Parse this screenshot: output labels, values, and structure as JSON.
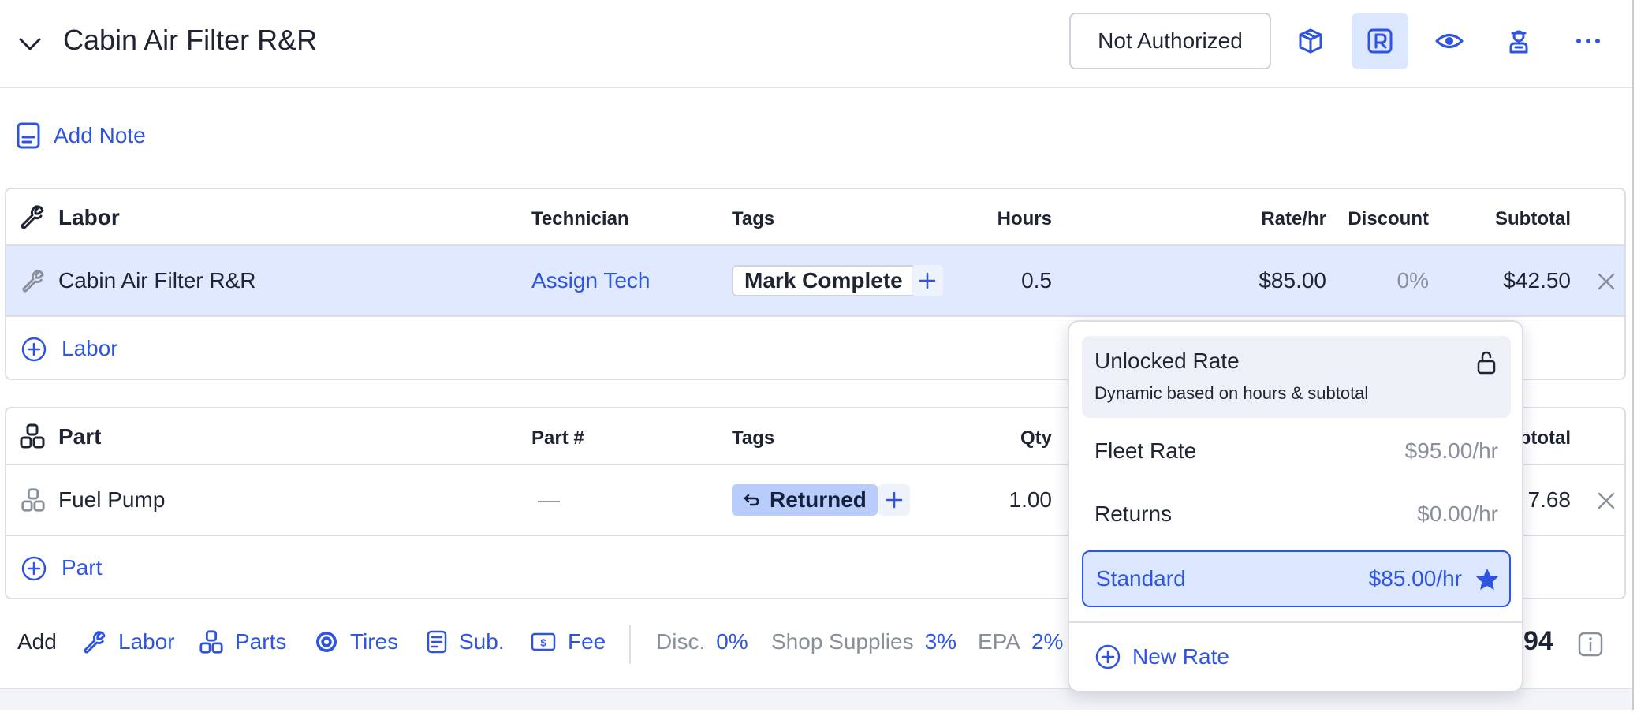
{
  "header": {
    "title": "Cabin Air Filter R&R",
    "authorization_status": "Not Authorized",
    "icons": [
      "chevron-down-icon",
      "package-icon",
      "r-badge-icon",
      "eye-icon",
      "technician-icon",
      "more-horizontal-icon"
    ]
  },
  "notes": {
    "add_label": "Add Note"
  },
  "labor_table": {
    "headers": {
      "section": "Labor",
      "technician": "Technician",
      "tags": "Tags",
      "hours": "Hours",
      "rate": "Rate/hr",
      "discount": "Discount",
      "subtotal": "Subtotal"
    },
    "rows": [
      {
        "name": "Cabin Air Filter R&R",
        "technician": "Assign Tech",
        "tag": "Mark Complete",
        "hours": "0.5",
        "rate": "$85.00",
        "discount": "0%",
        "subtotal": "$42.50"
      }
    ],
    "add_label": "Labor"
  },
  "part_table": {
    "headers": {
      "section": "Part",
      "part_number": "Part #",
      "tags": "Tags",
      "qty": "Qty",
      "subtotal_partial": "btotal"
    },
    "rows": [
      {
        "name": "Fuel Pump",
        "part_number": "—",
        "tag": "Returned",
        "qty": "1.00",
        "subtotal_partial": "7.68"
      }
    ],
    "add_label": "Part"
  },
  "footer": {
    "add_label": "Add",
    "add_items": [
      {
        "label": "Labor",
        "icon": "wrench-icon"
      },
      {
        "label": "Parts",
        "icon": "parts-icon"
      },
      {
        "label": "Tires",
        "icon": "tire-icon"
      },
      {
        "label": "Sub.",
        "icon": "sublet-icon"
      },
      {
        "label": "Fee",
        "icon": "fee-icon"
      }
    ],
    "disc_label": "Disc.",
    "disc_value": "0%",
    "shop_supplies_label": "Shop Supplies",
    "shop_supplies_value": "3%",
    "epa_label": "EPA",
    "epa_value": "2%",
    "total_partial": "94"
  },
  "rate_dropdown": {
    "unlocked": {
      "title": "Unlocked Rate",
      "description": "Dynamic based on hours & subtotal"
    },
    "options": [
      {
        "name": "Fleet Rate",
        "rate": "$95.00/hr"
      },
      {
        "name": "Returns",
        "rate": "$0.00/hr"
      },
      {
        "name": "Standard",
        "rate": "$85.00/hr",
        "selected": true,
        "default": true
      }
    ],
    "new_rate_label": "New Rate"
  },
  "colors": {
    "accent": "#2f55e0",
    "selected_row_bg": "#e0e9ff",
    "returned_tag_bg": "#b8cdfb",
    "border": "#dcdee4",
    "muted_text": "#8a8f9c"
  }
}
